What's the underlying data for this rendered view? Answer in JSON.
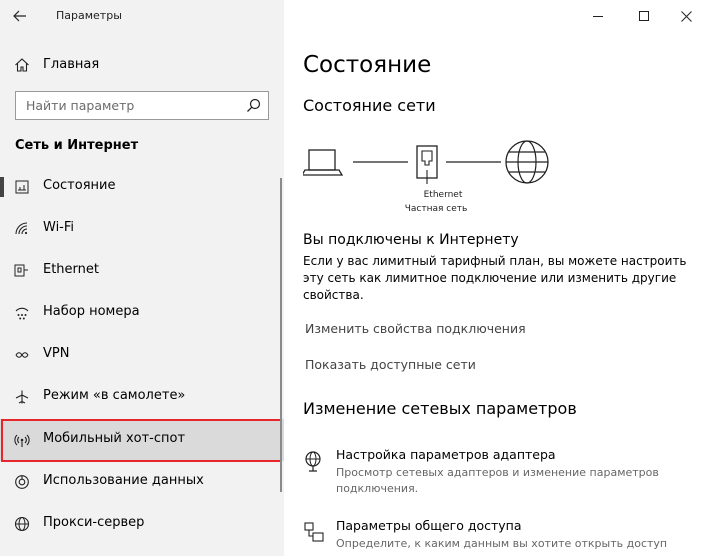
{
  "window": {
    "title": "Параметры",
    "controls": [
      "minimize",
      "maximize",
      "close"
    ]
  },
  "sidebar": {
    "home_label": "Главная",
    "search_placeholder": "Найти параметр",
    "section_title": "Сеть и Интернет",
    "items": [
      {
        "label": "Состояние",
        "icon": "status-icon",
        "selected": true
      },
      {
        "label": "Wi-Fi",
        "icon": "wifi-icon"
      },
      {
        "label": "Ethernet",
        "icon": "ethernet-icon"
      },
      {
        "label": "Набор номера",
        "icon": "dialup-icon"
      },
      {
        "label": "VPN",
        "icon": "vpn-icon"
      },
      {
        "label": "Режим «в самолете»",
        "icon": "airplane-icon"
      },
      {
        "label": "Мобильный хот-спот",
        "icon": "hotspot-icon",
        "highlighted": true
      },
      {
        "label": "Использование данных",
        "icon": "data-usage-icon"
      },
      {
        "label": "Прокси-сервер",
        "icon": "globe-icon"
      }
    ]
  },
  "main": {
    "title": "Состояние",
    "network_status_title": "Состояние сети",
    "diagram": {
      "adapter_name": "Ethernet",
      "network_type": "Частная сеть"
    },
    "connected_text": "Вы подключены к Интернету",
    "description": "Если у вас лимитный тарифный план, вы можете настроить эту сеть как лимитное подключение или изменить другие свойства.",
    "link_change_properties": "Изменить свойства подключения",
    "link_show_networks": "Показать доступные сети",
    "change_settings_title": "Изменение сетевых параметров",
    "settings": [
      {
        "title": "Настройка параметров адаптера",
        "description": "Просмотр сетевых адаптеров и изменение параметров подключения.",
        "icon": "adapter-icon"
      },
      {
        "title": "Параметры общего доступа",
        "description": "Определите, к каким данным вы хотите открыть доступ",
        "icon": "sharing-icon"
      }
    ]
  },
  "colors": {
    "sidebar_bg": "#f2f2f2",
    "highlight_border": "#e6262b",
    "hover_bg": "#dadada"
  }
}
